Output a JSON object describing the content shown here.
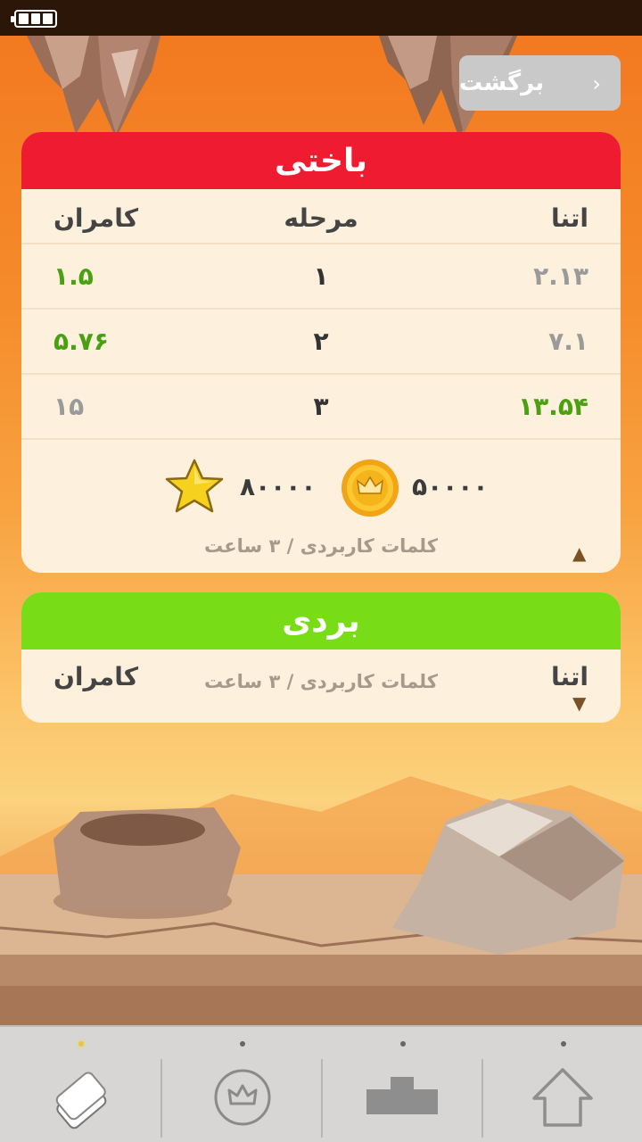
{
  "back_button": {
    "label": "برگشت"
  },
  "lose_card": {
    "title": "باختی",
    "headers": {
      "left": "کامران",
      "center": "مرحله",
      "right": "اتنا"
    },
    "rows": [
      {
        "left": "۱.۵",
        "center": "۱",
        "right": "۲.۱۳",
        "left_color": "green",
        "right_color": "gray"
      },
      {
        "left": "۵.۷۶",
        "center": "۲",
        "right": "۷.۱",
        "left_color": "green",
        "right_color": "gray"
      },
      {
        "left": "۱۵",
        "center": "۳",
        "right": "۱۳.۵۴",
        "left_color": "gray",
        "right_color": "green"
      }
    ],
    "rewards": {
      "star_amount": "۸۰۰۰۰",
      "coin_amount": "۵۰۰۰۰"
    },
    "footnote": "کلمات کاربردی / ۳ ساعت",
    "toggle_icon": "triangle-up-icon"
  },
  "win_card": {
    "title": "بردی",
    "left_name": "کامران",
    "right_name": "اتنا",
    "footnote": "کلمات کاربردی / ۳ ساعت",
    "toggle_icon": "triangle-down-icon"
  },
  "tabbar": {
    "tabs": [
      {
        "icon": "cards-icon",
        "active": true
      },
      {
        "icon": "crown-coin-icon",
        "active": false
      },
      {
        "icon": "podium-icon",
        "active": false
      },
      {
        "icon": "home-icon",
        "active": false
      }
    ]
  },
  "colors": {
    "lose_header": "#ee1b31",
    "win_header": "#78dc17",
    "card_bg": "#fdf0dc",
    "value_green": "#4aa013",
    "value_gray": "#9a9a9a"
  }
}
